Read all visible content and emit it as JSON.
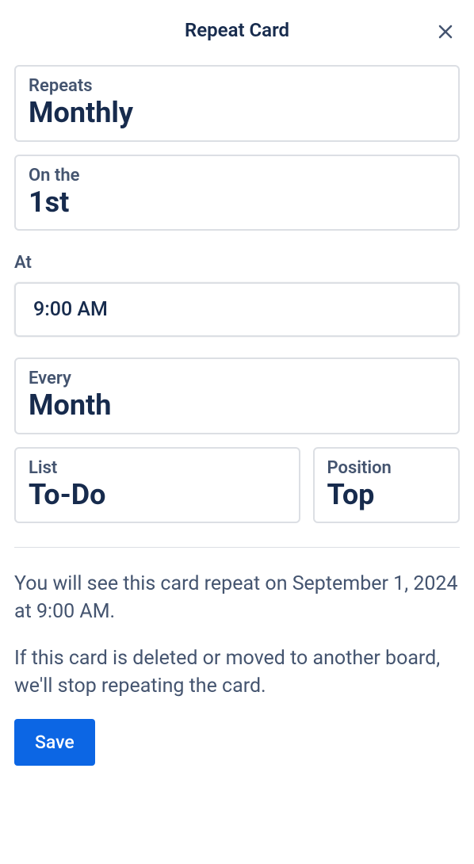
{
  "header": {
    "title": "Repeat Card"
  },
  "fields": {
    "repeats": {
      "label": "Repeats",
      "value": "Monthly"
    },
    "onthe": {
      "label": "On the",
      "value": "1st"
    },
    "at": {
      "label": "At",
      "value": "9:00 AM"
    },
    "every": {
      "label": "Every",
      "value": "Month"
    },
    "list": {
      "label": "List",
      "value": "To-Do"
    },
    "position": {
      "label": "Position",
      "value": "Top"
    }
  },
  "info": {
    "next_occurrence": "You will see this card repeat on September 1, 2024 at 9:00 AM.",
    "deletion_note": "If this card is deleted or moved to another board, we'll stop repeating the card."
  },
  "buttons": {
    "save": "Save"
  }
}
